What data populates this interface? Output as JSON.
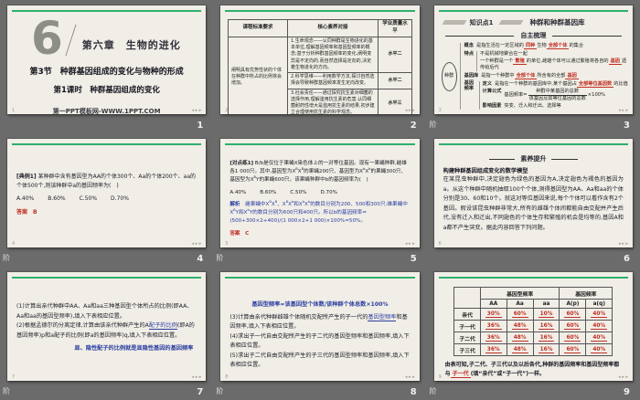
{
  "chrome": {
    "stage_label": "阶",
    "nav_icons": "◂ ▸ ▸"
  },
  "slides": {
    "s1": {
      "num": "1",
      "big_numeral": "6",
      "chapter": "第六章　生物的进化",
      "section_title": "第3节　种群基因组成的变化与物种的形成",
      "lesson_title": "第1课时　种群基因组成的变化",
      "site_footer": "第一PPT模板网-WWW.1PPT.COM"
    },
    "s2": {
      "num": "2",
      "headers": [
        "课程标准要求",
        "核心素养对接",
        "学业质量水平"
      ],
      "requirement": "阐明具有优势性状的个体在种群中所占的比例将会增加。",
      "rows": [
        {
          "literacy": "1.生命观念——认同种群是生物进化的基本单位,理解基因频率和基因型频率的概念;基于分析种群基因频率的变化,阐明变异是不定向的,而自然选择是定向的,决定着生物进化的方向。",
          "level": "水平二"
        },
        {
          "literacy": "2.科学思维——利用数学方法,探讨自然选择会导致种群基因频率发生定向改变。",
          "level": "水平二"
        },
        {
          "literacy": "3.社会责任——通过探究抗生素对细菌的选择作用,理解滥用抗生素的危害,认同细菌耐药性增大是滥用抗生素的结果,初步建立合理使用抗生素的科学观念。",
          "level": "水平三"
        }
      ]
    },
    "s3": {
      "num": "3",
      "badge": "知识点1",
      "title": "种群和种群基因库",
      "section": "自主梳理",
      "root": "种群",
      "b_concept_label": "概念",
      "b_concept": [
        {
          "t": "是指生活在一定区域的"
        },
        {
          "t": "同种",
          "c": "r"
        },
        {
          "t": "生物"
        },
        {
          "t": "全部个体",
          "c": "r"
        },
        {
          "t": "的集合"
        }
      ],
      "b_feature_label": "特点",
      "b_feature1": [
        {
          "t": "不是机械地聚合在一起"
        }
      ],
      "b_feature2": [
        {
          "t": "一个种群是一个"
        },
        {
          "t": "繁殖",
          "c": "r"
        },
        {
          "t": "的单位,雌雄个体可以通过繁殖将各自的"
        },
        {
          "t": "基因",
          "c": "r"
        },
        {
          "t": "遗传给后代"
        }
      ],
      "b_pool_label": "基因库",
      "b_pool": [
        {
          "t": "是指一个种群中"
        },
        {
          "t": "全部个体",
          "c": "r"
        },
        {
          "t": "所含有的全部"
        },
        {
          "t": "基因",
          "c": "r"
        }
      ],
      "b_freq_label": "基因频率",
      "freq_def_label": "定义",
      "freq_def": [
        {
          "t": "是指在一个种群的基因库中,某个基因占"
        },
        {
          "t": "全部等位基因数",
          "c": "r"
        },
        {
          "t": "的比值"
        }
      ],
      "freq_formula_label": "计算公式",
      "formula_prefix": "基因频率=",
      "formula_num": "种群中某基因的总数",
      "formula_den": "该基因及其等位基因的总数",
      "formula_suffix": "×100%",
      "freq_factors_label": "影响因素",
      "freq_factors": "突变、迁入和迁出、选择等"
    },
    "s4": {
      "num": "4",
      "tag": "[典例1]",
      "stem": "某种群中含有基因型为AA的个体300个、Aa的个体200个、aa的个体500个,则该种群中a的基因频率为(　)",
      "options": [
        "A.40%",
        "B.60%",
        "C.50%",
        "D.70%"
      ],
      "answer_label": "答案",
      "answer": "B"
    },
    "s5": {
      "num": "5",
      "tag": "[对点练1]",
      "stem": [
        {
          "t": "B/b是仅位于果蝇X染色体上的一对等位基因。现有一果蝇种群,雌雄各1 000只。其中,基因型为X"
        },
        {
          "t": "B",
          "c": "p"
        },
        {
          "t": "X"
        },
        {
          "t": "B",
          "c": "p"
        },
        {
          "t": "的果蝇200只、基因型为X"
        },
        {
          "t": "b",
          "c": "p"
        },
        {
          "t": "X"
        },
        {
          "t": "b",
          "c": "p"
        },
        {
          "t": "的果蝇300只、基因型为X"
        },
        {
          "t": "B",
          "c": "p"
        },
        {
          "t": "Y的果蝇600只。该果蝇种群中b的基因频率为(　)"
        }
      ],
      "options": [
        "A.40%",
        "B.60%",
        "C.50%",
        "D.70%"
      ],
      "analysis_label": "解析",
      "analysis": [
        {
          "t": "雌果蝇中X",
          "c": "b"
        },
        {
          "t": "B",
          "c": "b p"
        },
        {
          "t": "X",
          "c": "b"
        },
        {
          "t": "B",
          "c": "b p"
        },
        {
          "t": "、X",
          "c": "b"
        },
        {
          "t": "B",
          "c": "b p"
        },
        {
          "t": "X",
          "c": "b"
        },
        {
          "t": "b",
          "c": "b p"
        },
        {
          "t": "和X",
          "c": "b"
        },
        {
          "t": "b",
          "c": "b p"
        },
        {
          "t": "X",
          "c": "b"
        },
        {
          "t": "b",
          "c": "b p"
        },
        {
          "t": "的数目分别为200、500和300只;雄果蝇中X",
          "c": "b"
        },
        {
          "t": "B",
          "c": "b p"
        },
        {
          "t": "Y和X",
          "c": "b"
        },
        {
          "t": "b",
          "c": "b p"
        },
        {
          "t": "Y的数目分别为600只和400只。所以b的基因频率=(500+300×2+400)/(1 000×2+1 000)×100%=50%。",
          "c": "b"
        }
      ],
      "answer_label": "答案",
      "answer": "C"
    },
    "s6": {
      "num": "6",
      "header": "素养提升",
      "subtitle": "构建种群基因组成变化的数学模型",
      "body": "在某昆虫种群中,决定翅色为绿色的基因为A,决定翅色为褐色的基因为a。从这个种群中随机抽取100个个体,测得基因型为AA、Aa和aa的个体分别是30、60和10个。就这对等位基因来说,每个个体可以看作含有2个基因。假设该昆虫种群非常大,所有的雌雄个体间都能自由交配并产生后代,没有迁入和迁出,不同翅色的个体生存和繁殖的机会是均等的,基因A和a都不产生突变。据此内容回答下列问题。"
    },
    "s7": {
      "num": "7",
      "item1": "(1)计算出亲代种群中AA、Aa和aa三种基因型个体所占的比例(即AA、Aa和aa的基因型频率),填入下表相应位置。",
      "item2": [
        {
          "t": "(2)根据孟德尔的分离定律,计算由该亲代种群产生的A"
        },
        {
          "t": "配子的比例",
          "c": "u"
        },
        {
          "t": "(即A的基因频率)p和a配子的比例(即a的基因频率)q,填入下表相应位置。"
        }
      ],
      "note": "显、隐性配子的比例就是显隐性基因的基因频率"
    },
    "s8": {
      "num": "8",
      "formula": "基因型频率=该基因型个体数/该种群个体总数×100%",
      "item3": [
        {
          "t": "(3)计算由亲代种群雌雄个体随机交配所产生的子一代的"
        },
        {
          "t": "基因型频率",
          "c": "u"
        },
        {
          "t": "和基因频率,填入下表相应位置。"
        }
      ],
      "item4": "(4)求出子一代自由交配所产生的子二代的基因型频率和基因频率,填入下表相应位置。",
      "item5": "(5)求出子二代自由交配所产生的子三代的基因型频率和基因频率,填入下表相应位置。"
    },
    "s9": {
      "num": "9",
      "table": {
        "group1": "基因型频率",
        "group2": "基因频率",
        "cols": [
          "AA",
          "Aa",
          "aa",
          "A(p)",
          "a(q)"
        ],
        "rows": [
          {
            "label": "亲代",
            "v": [
              "30%",
              "60%",
              "10%",
              "60%",
              "40%"
            ]
          },
          {
            "label": "子一代",
            "v": [
              "36%",
              "48%",
              "16%",
              "60%",
              "40%"
            ]
          },
          {
            "label": "子二代",
            "v": [
              "36%",
              "48%",
              "16%",
              "60%",
              "40%"
            ]
          },
          {
            "label": "子三代",
            "v": [
              "36%",
              "48%",
              "16%",
              "60%",
              "40%"
            ]
          }
        ]
      },
      "conclusion": [
        {
          "t": "由表可知,子二代、子三代以及以后各代,种群的基因频率和基因型频率都与"
        },
        {
          "t": "子一代",
          "c": "r"
        },
        {
          "t": "(填“亲代”或“子一代”)一样。"
        }
      ]
    }
  }
}
